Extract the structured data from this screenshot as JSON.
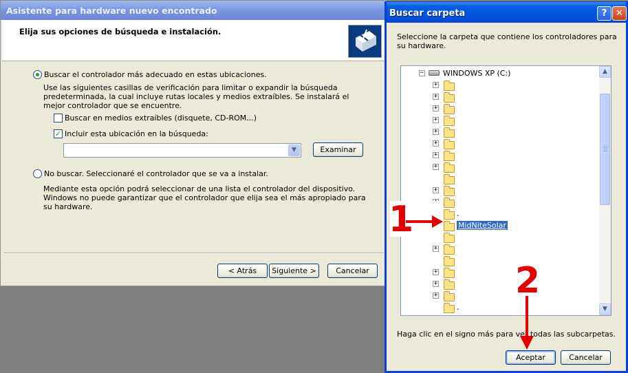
{
  "wizard": {
    "title": "Asistente para hardware nuevo encontrado",
    "header_title": "Elija sus opciones de búsqueda e instalación.",
    "option_search": {
      "label": "Buscar el controlador más adecuado en estas ubicaciones.",
      "selected": true,
      "description": "Use las siguientes casillas de verificación para limitar o expandir la búsqueda predeterminada, la cual incluye rutas locales y medios extraíbles. Se instalará el mejor controlador que se encuentre."
    },
    "check_removable": {
      "label": "Buscar en medios extraíbles (disquete, CD-ROM...)",
      "checked": false
    },
    "check_location": {
      "label": "Incluir esta ubicación en la búsqueda:",
      "checked": true
    },
    "location_value": "",
    "browse_button": "Examinar",
    "option_nosearch": {
      "label": "No buscar. Seleccionaré el controlador que se va a instalar.",
      "selected": false,
      "description": "Mediante esta opción podrá seleccionar de una lista el controlador del dispositivo. Windows no puede garantizar que el controlador que elija sea el más apropiado para su hardware."
    },
    "buttons": {
      "back": "< Atrás",
      "next": "Siguiente >",
      "cancel": "Cancelar"
    }
  },
  "browse": {
    "title": "Buscar carpeta",
    "help_icon": "?",
    "close_icon": "✕",
    "instruction": "Seleccione la carpeta que contiene los controladores para su hardware.",
    "drive_label": "WINDOWS XP (C:)",
    "drive_expander": "⊟",
    "tree_items": [
      {
        "label": "",
        "expander": "+"
      },
      {
        "label": "",
        "expander": "+"
      },
      {
        "label": "",
        "expander": "+"
      },
      {
        "label": "",
        "expander": "+"
      },
      {
        "label": "",
        "expander": "+"
      },
      {
        "label": "",
        "expander": "+"
      },
      {
        "label": "",
        "expander": "+"
      },
      {
        "label": "",
        "expander": "+"
      },
      {
        "label": "",
        "expander": ""
      },
      {
        "label": "",
        "expander": "+"
      },
      {
        "label": "",
        "expander": "+"
      },
      {
        "label": ".",
        "expander": ""
      },
      {
        "label": "MidNiteSolar",
        "expander": "",
        "selected": true
      },
      {
        "label": "",
        "expander": ""
      },
      {
        "label": "",
        "expander": "+"
      },
      {
        "label": "",
        "expander": ""
      },
      {
        "label": "",
        "expander": "+"
      },
      {
        "label": "",
        "expander": "+"
      },
      {
        "label": "",
        "expander": "+"
      },
      {
        "label": ".",
        "expander": ""
      }
    ],
    "hint": "Haga clic en el signo más para ver todas las subcarpetas.",
    "buttons": {
      "ok": "Aceptar",
      "cancel": "Cancelar"
    }
  },
  "annotations": {
    "step1": "1",
    "step2": "2",
    "color": "#e00000"
  },
  "colors": {
    "xp_blue": "#0a5fe0",
    "selection": "#316ac5",
    "dialog_bg": "#ece9d8"
  }
}
